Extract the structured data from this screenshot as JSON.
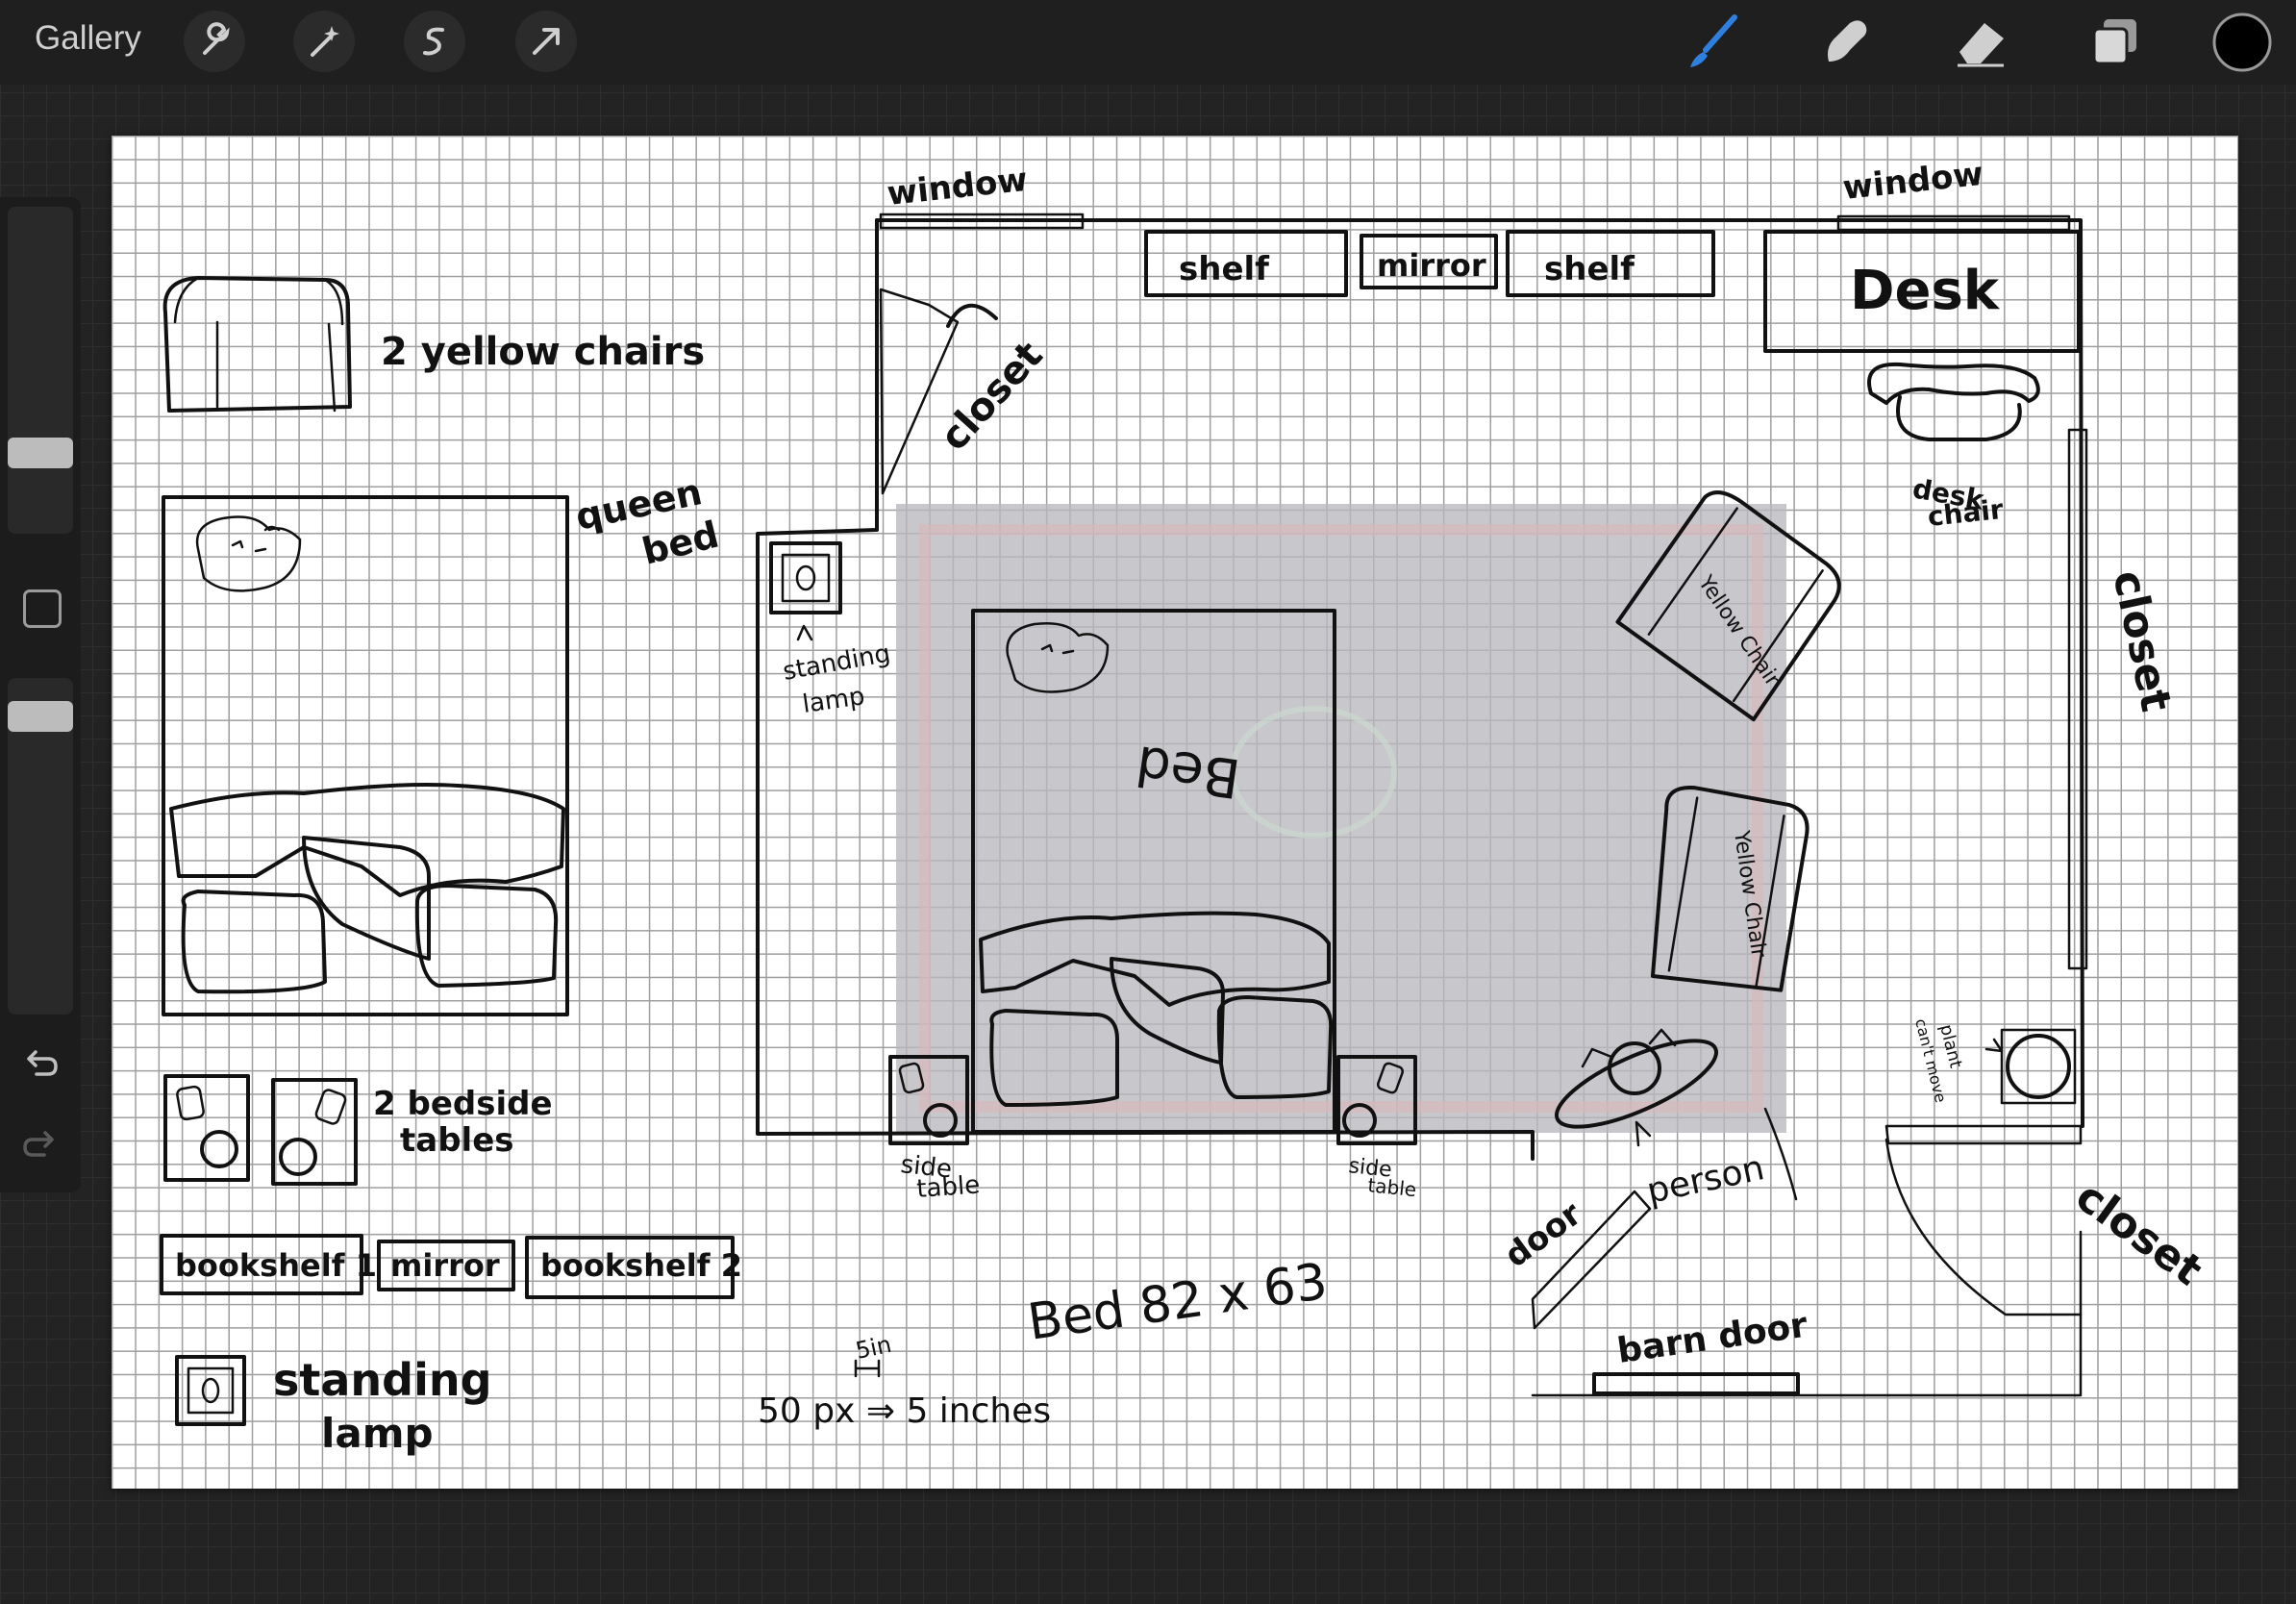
{
  "app": {
    "gallery_label": "Gallery",
    "toolbar_left_icons": [
      "wrench-icon",
      "magic-wand-icon",
      "selection-s-icon",
      "arrow-transform-icon"
    ],
    "toolbar_right_icons": [
      "brush-icon",
      "smudge-icon",
      "eraser-icon",
      "layers-icon",
      "color-swatch"
    ],
    "brush_color": "#2f7fe0",
    "current_color": "#000000",
    "sidebar_icons": [
      "undo-icon",
      "redo-icon",
      "modify-square-icon"
    ],
    "brush_size_level": 0.35,
    "opacity_level": 0.8
  },
  "drawing": {
    "legend": {
      "yellow_chairs": "2 yellow chairs",
      "queen_bed_1": "queen",
      "queen_bed_2": "bed",
      "bedside_tables_1": "2 bedside",
      "bedside_tables_2": "tables",
      "bookshelf1": "bookshelf 1",
      "mirror": "mirror",
      "bookshelf2": "bookshelf 2",
      "standing_lamp_1": "standing",
      "standing_lamp_2": "lamp"
    },
    "room": {
      "window_left": "window",
      "window_right": "window",
      "shelf_left": "shelf",
      "mirror": "mirror",
      "shelf_right": "shelf",
      "desk": "Desk",
      "closet_top": "closet",
      "closet_right": "closet",
      "closet_bottom_right": "closet",
      "desk_chair_1": "desk",
      "desk_chair_2": "chair",
      "standing_lamp_1": "standing",
      "standing_lamp_2": "lamp",
      "bed_label": "Bed",
      "yellow_chair_1": "Yellow Chair",
      "yellow_chair_2": "Yellow Chair",
      "side_table_left_1": "side",
      "side_table_left_2": "table",
      "side_table_right_1": "side",
      "side_table_right_2": "table",
      "person": "person",
      "door": "door",
      "barn_door": "barn door",
      "plant_1": "plant",
      "plant_2": "can't move",
      "bed_size": "Bed 82 x 63",
      "scale_small": "5in",
      "scale_text": "50 px ⇒ 5 inches"
    },
    "colors": {
      "chair_yellow": "#d9b84a",
      "rug_gray": "#b9b7bd",
      "ink": "#111111"
    }
  }
}
